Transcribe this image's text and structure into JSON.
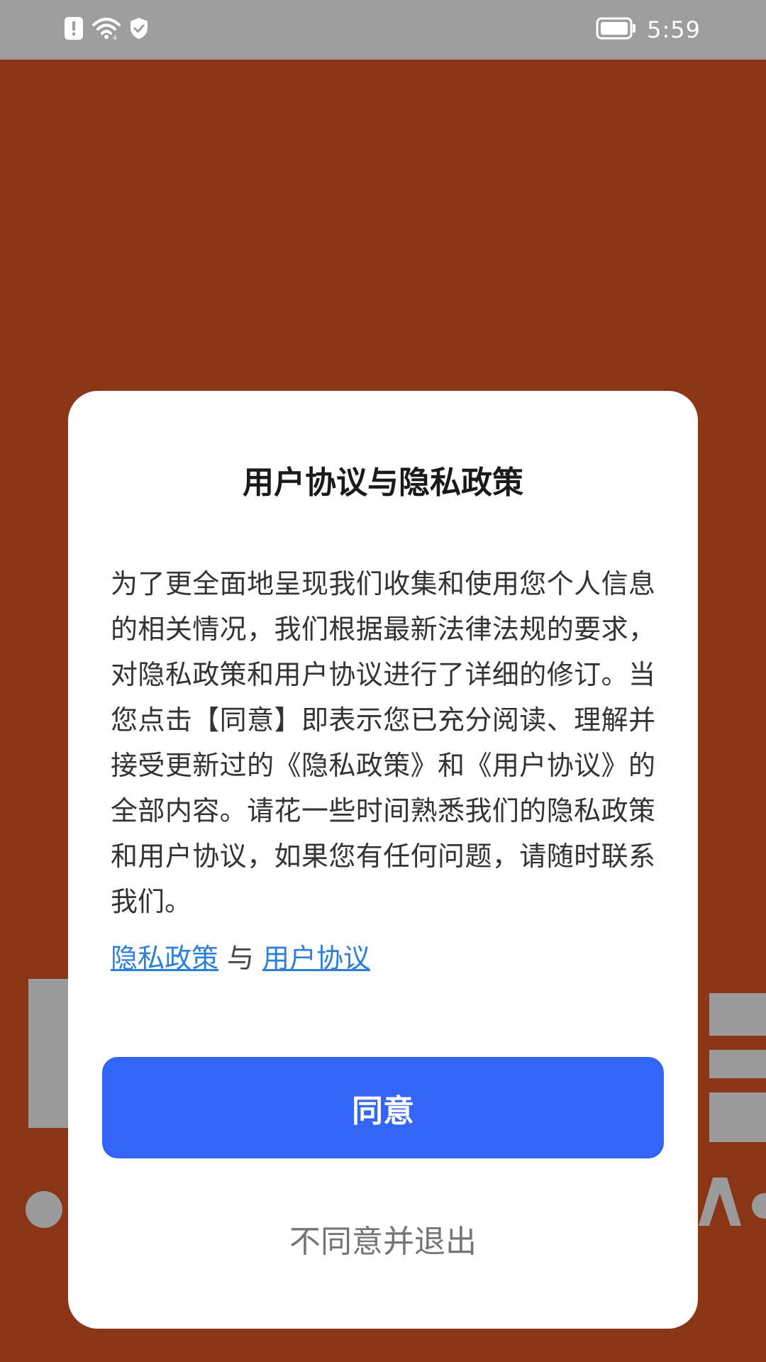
{
  "status_bar": {
    "time": "5:59",
    "icons": [
      "alert-icon",
      "wifi-icon",
      "shield-icon",
      "battery-icon"
    ]
  },
  "dialog": {
    "title": "用户协议与隐私政策",
    "body": "为了更全面地呈现我们收集和使用您个人信息的相关情况，我们根据最新法律法规的要求，对隐私政策和用户协议进行了详细的修订。当您点击【同意】即表示您已充分阅读、理解并接受更新过的《隐私政策》和《用户协议》的全部内容。请花一些时间熟悉我们的隐私政策和用户协议，如果您有任何问题，请随时联系我们。",
    "links": {
      "privacy_label": "隐私政策",
      "separator": "与",
      "agreement_label": "用户协议"
    },
    "agree_label": "同意",
    "decline_label": "不同意并退出"
  },
  "colors": {
    "background": "#8a3516",
    "status_bar": "#9d9d9d",
    "primary_button": "#3366f6",
    "link": "#2e7fd8"
  }
}
